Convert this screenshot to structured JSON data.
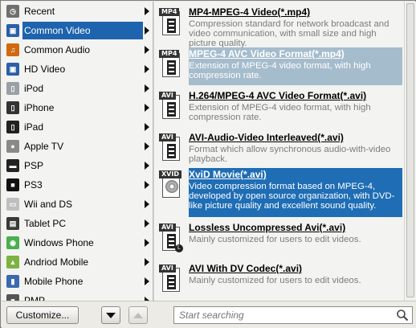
{
  "categories": [
    {
      "label": "Recent",
      "icon": "recent-icon",
      "color": "#6f6f6f"
    },
    {
      "label": "Common Video",
      "icon": "video-film-icon",
      "color": "#2b5fa6",
      "selected": true
    },
    {
      "label": "Common Audio",
      "icon": "audio-note-icon",
      "color": "#d06a10"
    },
    {
      "label": "HD Video",
      "icon": "hd-film-icon",
      "color": "#2b5fa6"
    },
    {
      "label": "iPod",
      "icon": "ipod-icon",
      "color": "#9aa0a6"
    },
    {
      "label": "iPhone",
      "icon": "iphone-icon",
      "color": "#333333"
    },
    {
      "label": "iPad",
      "icon": "ipad-icon",
      "color": "#222222"
    },
    {
      "label": "Apple TV",
      "icon": "apple-icon",
      "color": "#8a8a8a"
    },
    {
      "label": "PSP",
      "icon": "psp-icon",
      "color": "#222222"
    },
    {
      "label": "PS3",
      "icon": "ps3-icon",
      "color": "#111111"
    },
    {
      "label": "Wii and DS",
      "icon": "wii-icon",
      "color": "#bfbfbf"
    },
    {
      "label": "Tablet PC",
      "icon": "tablet-icon",
      "color": "#3a3a3a"
    },
    {
      "label": "Windows Phone",
      "icon": "windows-phone-icon",
      "color": "#4caf50"
    },
    {
      "label": "Andriod Mobile",
      "icon": "android-icon",
      "color": "#7cb342"
    },
    {
      "label": "Mobile Phone",
      "icon": "mobile-phone-icon",
      "color": "#3a6ab0"
    },
    {
      "label": "PMP",
      "icon": "pmp-icon",
      "color": "#555555"
    }
  ],
  "formats": [
    {
      "tag": "MP4",
      "title": "MP4-MPEG-4 Video(*.mp4)",
      "desc": "Compression standard for network broadcast and video communication, with small size and high picture quality.",
      "state": "normal"
    },
    {
      "tag": "MP4",
      "title": "MPEG-4 AVC Video Format(*.mp4)",
      "desc": "Extension of MPEG-4 video format, with high compression rate.",
      "state": "hover"
    },
    {
      "tag": "AVI",
      "title": "H.264/MPEG-4 AVC Video Format(*.avi)",
      "desc": "Extension of MPEG-4 video format, with high compression rate.",
      "state": "normal"
    },
    {
      "tag": "AVI",
      "title": "AVI-Audio-Video Interleaved(*.avi)",
      "desc": "Format which allow synchronous audio-with-video playback.",
      "state": "normal"
    },
    {
      "tag": "XVID",
      "title": "XviD Movie(*.avi)",
      "desc": "Video compression format based on MPEG-4, developed by open source organization, with DVD-like picture quality and excellent sound quality.",
      "state": "selected"
    },
    {
      "tag": "AVI",
      "title": "Lossless Uncompressed Avi(*.avi)",
      "desc": "Mainly customized for users to edit videos.",
      "state": "normal",
      "badge": "L"
    },
    {
      "tag": "AVI",
      "title": "AVI With DV Codec(*.avi)",
      "desc": "Mainly customized for users to edit videos.",
      "state": "normal"
    }
  ],
  "toolbar": {
    "customize_label": "Customize...",
    "search_placeholder": "Start searching"
  },
  "colors": {
    "selection": "#1e63ad",
    "hover": "#a5bccc"
  }
}
